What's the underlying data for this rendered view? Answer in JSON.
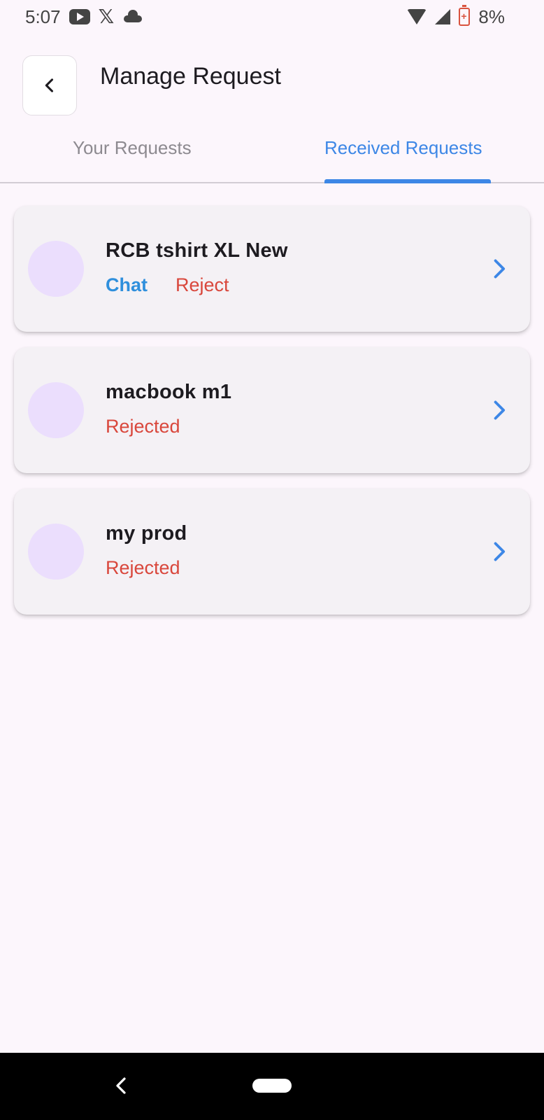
{
  "status_bar": {
    "time": "5:07",
    "battery": "8%",
    "icons": [
      "youtube-icon",
      "x-icon",
      "cloud-icon",
      "wifi-icon",
      "signal-icon",
      "battery-icon"
    ]
  },
  "header": {
    "title": "Manage Request",
    "back_icon": "chevron-left-icon"
  },
  "tabs": [
    {
      "label": "Your Requests",
      "active": false
    },
    {
      "label": "Received Requests",
      "active": true
    }
  ],
  "requests": [
    {
      "title": "RCB tshirt XL New",
      "actions": {
        "chat": "Chat",
        "reject": "Reject"
      }
    },
    {
      "title": "macbook m1",
      "status": "Rejected"
    },
    {
      "title": "my prod",
      "status": "Rejected"
    }
  ],
  "colors": {
    "accent": "#3d87e6",
    "chat": "#2f8fdc",
    "reject": "#d9473c",
    "avatar": "#ebdefd",
    "card": "#f4f1f5",
    "background": "#fcf6fc"
  }
}
